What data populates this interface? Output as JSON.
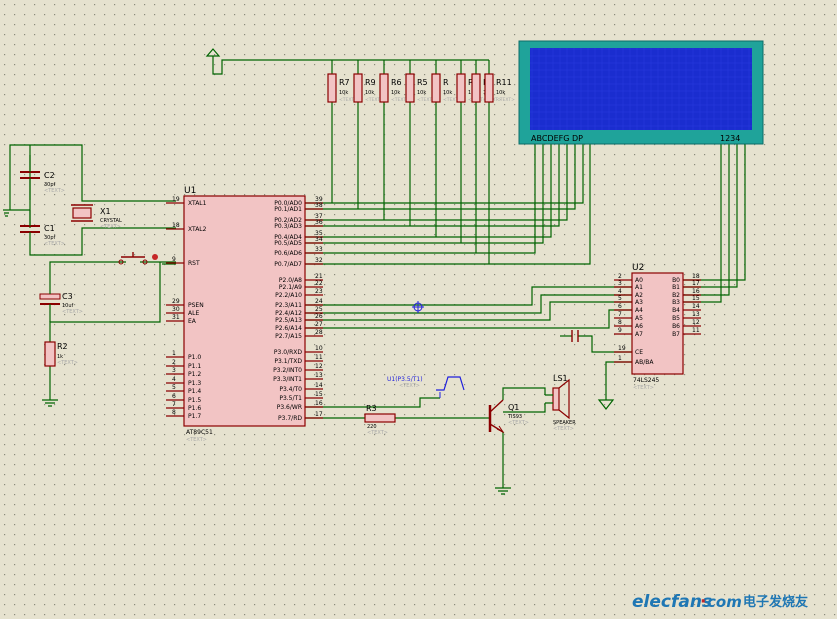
{
  "colors": {
    "background": "#e6e2cf",
    "grid_dot": "#8a8a7a",
    "wire": "#006400",
    "part": "#8b0000",
    "chip_fill": "#f2c4c4",
    "label": "#000000",
    "text_placeholder": "#a8a8a8",
    "lcd_fill": "#1a2dcf",
    "lcd_frame": "#1fa39a",
    "probe": "#1f1fdd",
    "watermark": "#1f77b4",
    "watermark_accent": "#c62828"
  },
  "placeholder": "<TEXT>",
  "resistor_array": [
    {
      "ref": "R7",
      "value": "10k"
    },
    {
      "ref": "R9",
      "value": "10k"
    },
    {
      "ref": "R6",
      "value": "10k"
    },
    {
      "ref": "R5",
      "value": "10k"
    },
    {
      "ref": "R",
      "value": "10k"
    },
    {
      "ref": "R1",
      "value": "10k"
    },
    {
      "ref": "R8",
      "value": "10k"
    },
    {
      "ref": "R11",
      "value": "10k"
    }
  ],
  "lcd": {
    "segment_label": "ABCDEFG DP",
    "digit_label": "1234"
  },
  "capacitors": {
    "c2": {
      "ref": "C2",
      "value": "30pf"
    },
    "c1": {
      "ref": "C1",
      "value": "30pf"
    },
    "c3": {
      "ref": "C3",
      "value": "10uf"
    }
  },
  "crystal": {
    "ref": "X1",
    "value": "CRYSTAL"
  },
  "r2": {
    "ref": "R2",
    "value": "1k"
  },
  "r3": {
    "ref": "R3",
    "value": "220"
  },
  "u1": {
    "ref": "U1",
    "part": "AT89C51",
    "left_pins": [
      {
        "num": "19",
        "name": "XTAL1"
      },
      {
        "num": "18",
        "name": "XTAL2"
      },
      {
        "num": "9",
        "name": "RST"
      },
      {
        "num": "29",
        "name": "PSEN"
      },
      {
        "num": "30",
        "name": "ALE"
      },
      {
        "num": "31",
        "name": "EA"
      },
      {
        "num": "1",
        "name": "P1.0"
      },
      {
        "num": "2",
        "name": "P1.1"
      },
      {
        "num": "3",
        "name": "P1.2"
      },
      {
        "num": "4",
        "name": "P1.3"
      },
      {
        "num": "5",
        "name": "P1.4"
      },
      {
        "num": "6",
        "name": "P1.5"
      },
      {
        "num": "7",
        "name": "P1.6"
      },
      {
        "num": "8",
        "name": "P1.7"
      }
    ],
    "right_pins": [
      {
        "num": "39",
        "name": "P0.0/AD0"
      },
      {
        "num": "38",
        "name": "P0.1/AD1"
      },
      {
        "num": "37",
        "name": "P0.2/AD2"
      },
      {
        "num": "36",
        "name": "P0.3/AD3"
      },
      {
        "num": "35",
        "name": "P0.4/AD4"
      },
      {
        "num": "34",
        "name": "P0.5/AD5"
      },
      {
        "num": "33",
        "name": "P0.6/AD6"
      },
      {
        "num": "32",
        "name": "P0.7/AD7"
      },
      {
        "num": "21",
        "name": "P2.0/A8"
      },
      {
        "num": "22",
        "name": "P2.1/A9"
      },
      {
        "num": "23",
        "name": "P2.2/A10"
      },
      {
        "num": "24",
        "name": "P2.3/A11"
      },
      {
        "num": "25",
        "name": "P2.4/A12"
      },
      {
        "num": "26",
        "name": "P2.5/A13"
      },
      {
        "num": "27",
        "name": "P2.6/A14"
      },
      {
        "num": "28",
        "name": "P2.7/A15"
      },
      {
        "num": "10",
        "name": "P3.0/RXD"
      },
      {
        "num": "11",
        "name": "P3.1/TXD"
      },
      {
        "num": "12",
        "name": "P3.2/INT0"
      },
      {
        "num": "13",
        "name": "P3.3/INT1"
      },
      {
        "num": "14",
        "name": "P3.4/T0"
      },
      {
        "num": "15",
        "name": "P3.5/T1"
      },
      {
        "num": "16",
        "name": "P3.6/WR"
      },
      {
        "num": "17",
        "name": "P3.7/RD"
      }
    ]
  },
  "u2": {
    "ref": "U2",
    "part": "74LS245",
    "left_pins": [
      {
        "num": "2",
        "name": "A0"
      },
      {
        "num": "3",
        "name": "A1"
      },
      {
        "num": "4",
        "name": "A2"
      },
      {
        "num": "5",
        "name": "A3"
      },
      {
        "num": "6",
        "name": "A4"
      },
      {
        "num": "7",
        "name": "A5"
      },
      {
        "num": "8",
        "name": "A6"
      },
      {
        "num": "9",
        "name": "A7"
      },
      {
        "num": "19",
        "name": "CE"
      },
      {
        "num": "1",
        "name": "AB/BA"
      }
    ],
    "right_pins": [
      {
        "num": "18",
        "name": "B0"
      },
      {
        "num": "17",
        "name": "B1"
      },
      {
        "num": "16",
        "name": "B2"
      },
      {
        "num": "15",
        "name": "B3"
      },
      {
        "num": "14",
        "name": "B4"
      },
      {
        "num": "13",
        "name": "B5"
      },
      {
        "num": "12",
        "name": "B6"
      },
      {
        "num": "11",
        "name": "B7"
      }
    ]
  },
  "q1": {
    "ref": "Q1",
    "value": "TIS93"
  },
  "ls1": {
    "ref": "LS1",
    "value": "SPEAKER"
  },
  "probe_label": "U1(P3.5/T1)",
  "watermark": {
    "brand": "elecfans",
    "dot": "·",
    "domain": "com",
    "chinese": "电子发烧友"
  }
}
